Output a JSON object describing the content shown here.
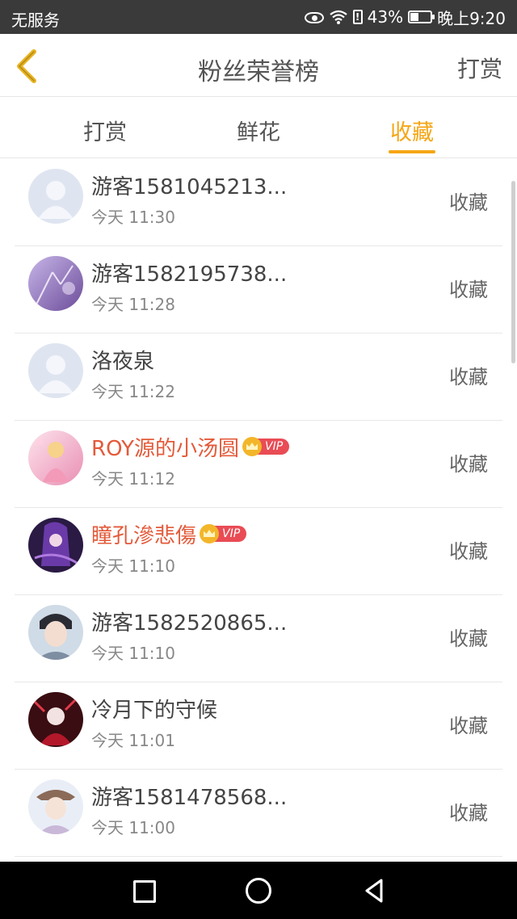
{
  "status_bar": {
    "carrier": "无服务",
    "battery_percent": "43%",
    "battery_level": 0.43,
    "time": "晚上9:20"
  },
  "header": {
    "title": "粉丝荣誉榜",
    "action_label": "打赏"
  },
  "tabs": [
    {
      "label": "打赏",
      "active": false
    },
    {
      "label": "鲜花",
      "active": false
    },
    {
      "label": "收藏",
      "active": true
    }
  ],
  "accent_color": "#f5a615",
  "vip_name_color": "#e35a3a",
  "fans": [
    {
      "name": "游客1581045213...",
      "time": "今天 11:30",
      "gift": "收藏",
      "vip": false,
      "vip_label": ""
    },
    {
      "name": "游客1582195738...",
      "time": "今天 11:28",
      "gift": "收藏",
      "vip": false,
      "vip_label": ""
    },
    {
      "name": "洛夜泉",
      "time": "今天 11:22",
      "gift": "收藏",
      "vip": false,
      "vip_label": ""
    },
    {
      "name": "ROY源的小汤圆",
      "time": "今天 11:12",
      "gift": "收藏",
      "vip": true,
      "vip_label": "VIP"
    },
    {
      "name": "瞳孔滲悲傷",
      "time": "今天 11:10",
      "gift": "收藏",
      "vip": true,
      "vip_label": "VIP"
    },
    {
      "name": "游客1582520865...",
      "time": "今天 11:10",
      "gift": "收藏",
      "vip": false,
      "vip_label": ""
    },
    {
      "name": "冷月下的守候",
      "time": "今天 11:01",
      "gift": "收藏",
      "vip": false,
      "vip_label": ""
    },
    {
      "name": "游客1581478568...",
      "time": "今天 11:00",
      "gift": "收藏",
      "vip": false,
      "vip_label": ""
    }
  ]
}
